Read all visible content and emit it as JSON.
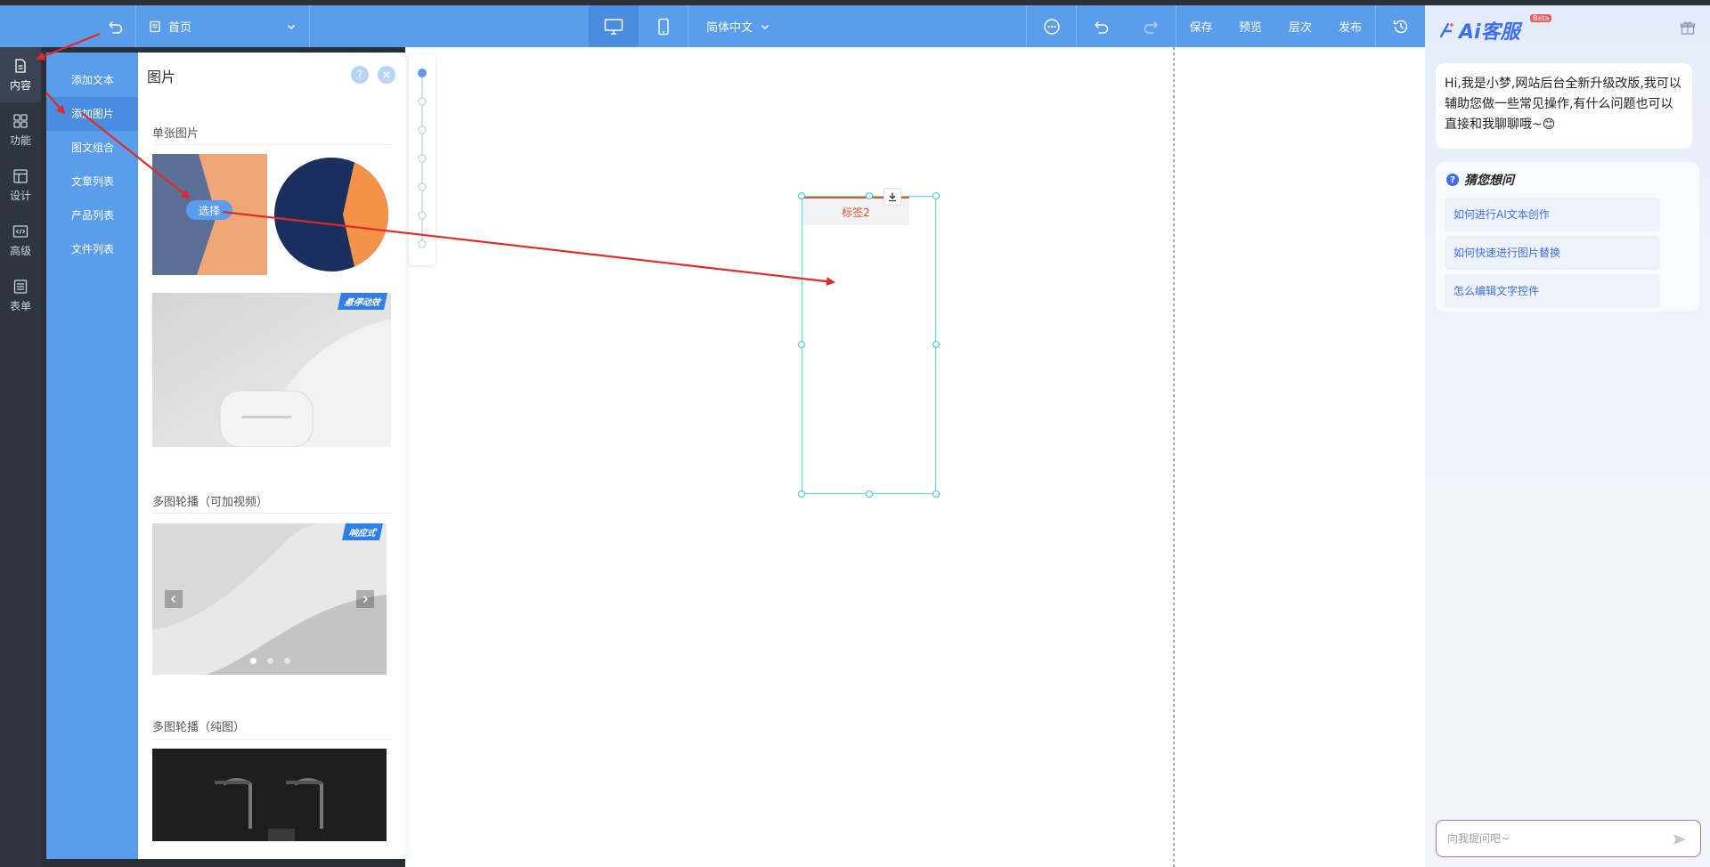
{
  "toolbar": {
    "page_name": "首页",
    "language": "简体中文",
    "save_label": "保存",
    "preview_label": "预览",
    "layers_label": "层次",
    "publish_label": "发布"
  },
  "rail": {
    "items": [
      {
        "label": "内容",
        "icon": "file-icon"
      },
      {
        "label": "功能",
        "icon": "grid-icon"
      },
      {
        "label": "设计",
        "icon": "layout-icon"
      },
      {
        "label": "高级",
        "icon": "code-icon"
      },
      {
        "label": "表单",
        "icon": "list-icon"
      }
    ]
  },
  "submenu": {
    "items": [
      "添加文本",
      "添加图片",
      "图文组合",
      "文章列表",
      "产品列表",
      "文件列表"
    ]
  },
  "panel": {
    "title": "图片",
    "help": "?",
    "sections": {
      "single": "单张图片",
      "carousel_video": "多图轮播（可加视频）",
      "carousel_pure": "多图轮播（纯图）"
    },
    "select_label": "选择",
    "badge_hover": "悬停动效",
    "badge_responsive": "响应式"
  },
  "canvas": {
    "tab_label": "标签2"
  },
  "ai": {
    "logo": "Ai客服",
    "beta": "Beta",
    "greeting": "Hi,我是小梦,网站后台全新升级改版,我可以辅助您做一些常见操作,有什么问题也可以直接和我聊聊哦~😊",
    "guess_title": "猜您想问",
    "questions": [
      "如何进行AI文本创作",
      "如何快速进行图片替换",
      "怎么编辑文字控件"
    ],
    "input_placeholder": "向我提问吧~"
  },
  "colors": {
    "accent": "#5b9ded",
    "rail": "#2f3540",
    "annotation": "#e02a2a",
    "tab_active": "#e2582a",
    "ai_blue": "#3d6ff0"
  }
}
